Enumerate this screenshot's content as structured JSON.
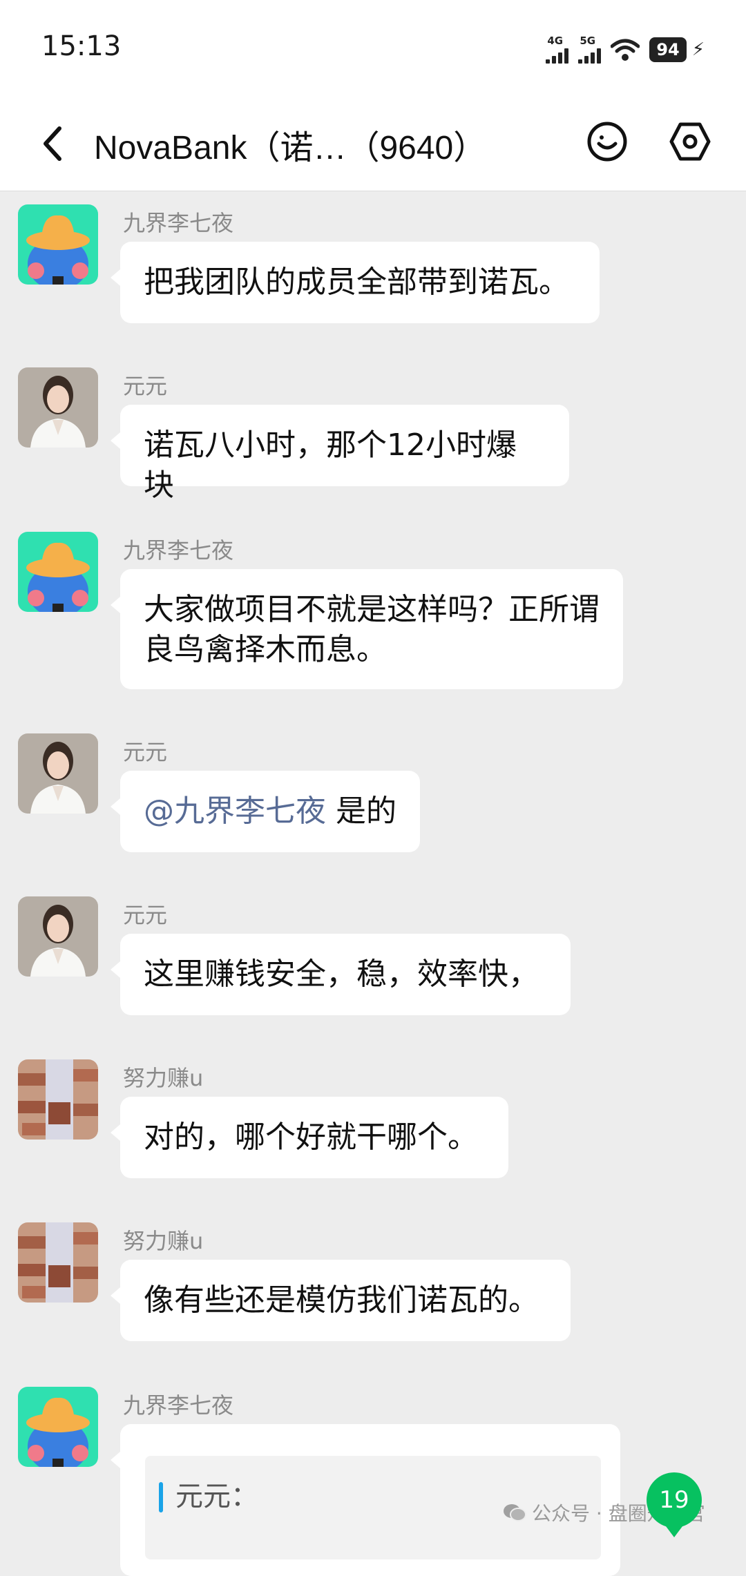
{
  "status_bar": {
    "time": "15:13",
    "network_1": "4G",
    "network_2": "5G",
    "battery_level": "94",
    "icons": [
      "signal-icon",
      "wifi-icon",
      "battery-icon",
      "charging-icon"
    ]
  },
  "header": {
    "title": "NovaBank（诺…（9640）",
    "icons": [
      "back-arrow-icon",
      "emoji-icon",
      "settings-hexagon-icon"
    ]
  },
  "messages": [
    {
      "sender": "九界李七夜",
      "text": "把我团队的成员全部带到诺瓦。",
      "avatar": "cartoon-hat-avatar"
    },
    {
      "sender": "元元",
      "text": "诺瓦八小时，那个12小时爆块",
      "avatar": "woman-photo-avatar"
    },
    {
      "sender": "九界李七夜",
      "text": "大家做项目不就是这样吗？正所谓良鸟禽择木而息。",
      "avatar": "cartoon-hat-avatar"
    },
    {
      "sender": "元元",
      "mention": "@九界李七夜",
      "text": " 是的",
      "avatar": "woman-photo-avatar"
    },
    {
      "sender": "元元",
      "text": "这里赚钱安全，稳，效率快，",
      "avatar": "woman-photo-avatar"
    },
    {
      "sender": "努力赚u",
      "text": "对的，哪个好就干哪个。",
      "avatar": "bricks-photo-avatar"
    },
    {
      "sender": "努力赚u",
      "text": "像有些还是模仿我们诺瓦的。",
      "avatar": "bricks-photo-avatar"
    },
    {
      "sender": "九界李七夜",
      "quote_name": "元元：",
      "avatar": "cartoon-hat-avatar"
    }
  ],
  "unread_badge": "19",
  "watermark": "公众号 · 盘圈知识官",
  "colors": {
    "background": "#ededed",
    "bubble": "#ffffff",
    "mention": "#576b95",
    "badge": "#07c160",
    "quote_bar": "#1aa3e8"
  }
}
